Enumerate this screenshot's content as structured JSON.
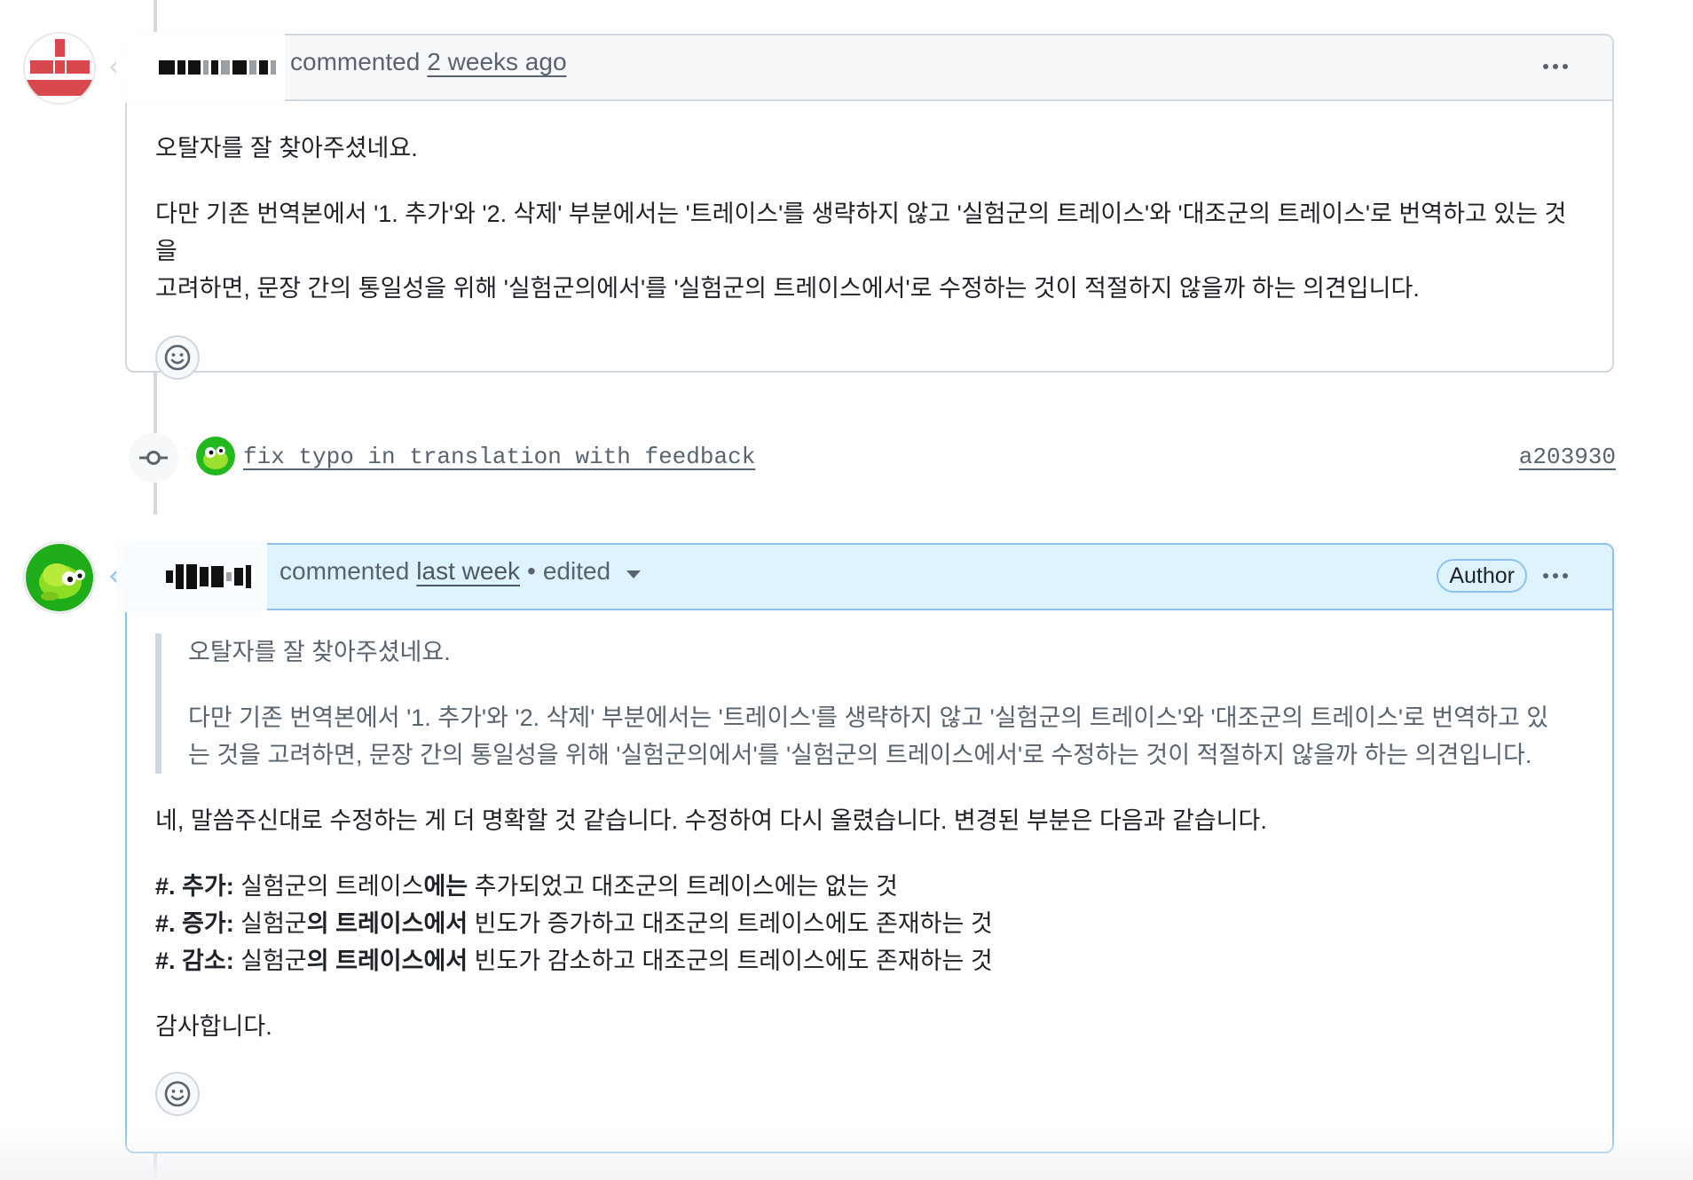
{
  "comment1": {
    "action": "commented",
    "time": "2 weeks ago",
    "body": {
      "p1": "오탈자를 잘 찾아주셨네요.",
      "p2_line1": "다만 기존 번역본에서 '1. 추가'와 '2. 삭제' 부분에서는 '트레이스'를 생략하지 않고 '실험군의 트레이스'와 '대조군의 트레이스'로 번역하고 있는 것을",
      "p2_line2": "고려하면, 문장 간의 통일성을 위해 '실험군의에서'를 '실험군의 트레이스에서'로 수정하는 것이 적절하지 않을까 하는 의견입니다."
    },
    "avatar_icon": "identicon-avatar",
    "reaction_icon": "smiley-icon",
    "menu_icon": "kebab-horizontal-icon"
  },
  "commit": {
    "icon": "git-commit-icon",
    "message": "fix typo in translation with feedback",
    "sha": "a203930",
    "avatar_icon": "frog-avatar"
  },
  "comment2": {
    "action": "commented",
    "time": "last week",
    "separator": "•",
    "edited": "edited",
    "badge": "Author",
    "quote": {
      "p1": "오탈자를 잘 찾아주셨네요.",
      "p2_line1": "다만 기존 번역본에서 '1. 추가'와 '2. 삭제' 부분에서는 '트레이스'를 생략하지 않고 '실험군의 트레이스'와 '대조군의 트레이스'로 번역하고 있",
      "p2_line2": "는 것을 고려하면, 문장 간의 통일성을 위해 '실험군의에서'를 '실험군의 트레이스에서'로 수정하는 것이 적절하지 않을까 하는 의견입니다."
    },
    "reply": "네, 말씀주신대로 수정하는 게 더 명확할 것 같습니다. 수정하여 다시 올렸습니다. 변경된 부분은 다음과 같습니다.",
    "items": [
      {
        "prefix": "#.",
        "label": "추가:",
        "t1": "실험군의 트레이스",
        "b1": "에는",
        "t2": "추가되었고 대조군의 트레이스에는 없는 것"
      },
      {
        "prefix": "#.",
        "label": "증가:",
        "t1": "실험군",
        "b1": "의 트레이스에서",
        "t2": "빈도가 증가하고 대조군의 트레이스에도 존재하는 것"
      },
      {
        "prefix": "#.",
        "label": "감소:",
        "t1": "실험군",
        "b1": "의 트레이스에서",
        "t2": "빈도가 감소하고 대조군의 트레이스에도 존재하는 것"
      }
    ],
    "thanks": "감사합니다.",
    "avatar_icon": "frog-avatar",
    "reaction_icon": "smiley-icon",
    "menu_icon": "kebab-horizontal-icon",
    "dropdown_icon": "triangle-down-icon"
  },
  "colors": {
    "border": "#d0d7de",
    "author_border": "#8fc1ed",
    "author_header_bg": "#ddf4ff",
    "header_bg": "#f6f8fa",
    "muted_text": "#59636e",
    "text": "#1f2328"
  }
}
